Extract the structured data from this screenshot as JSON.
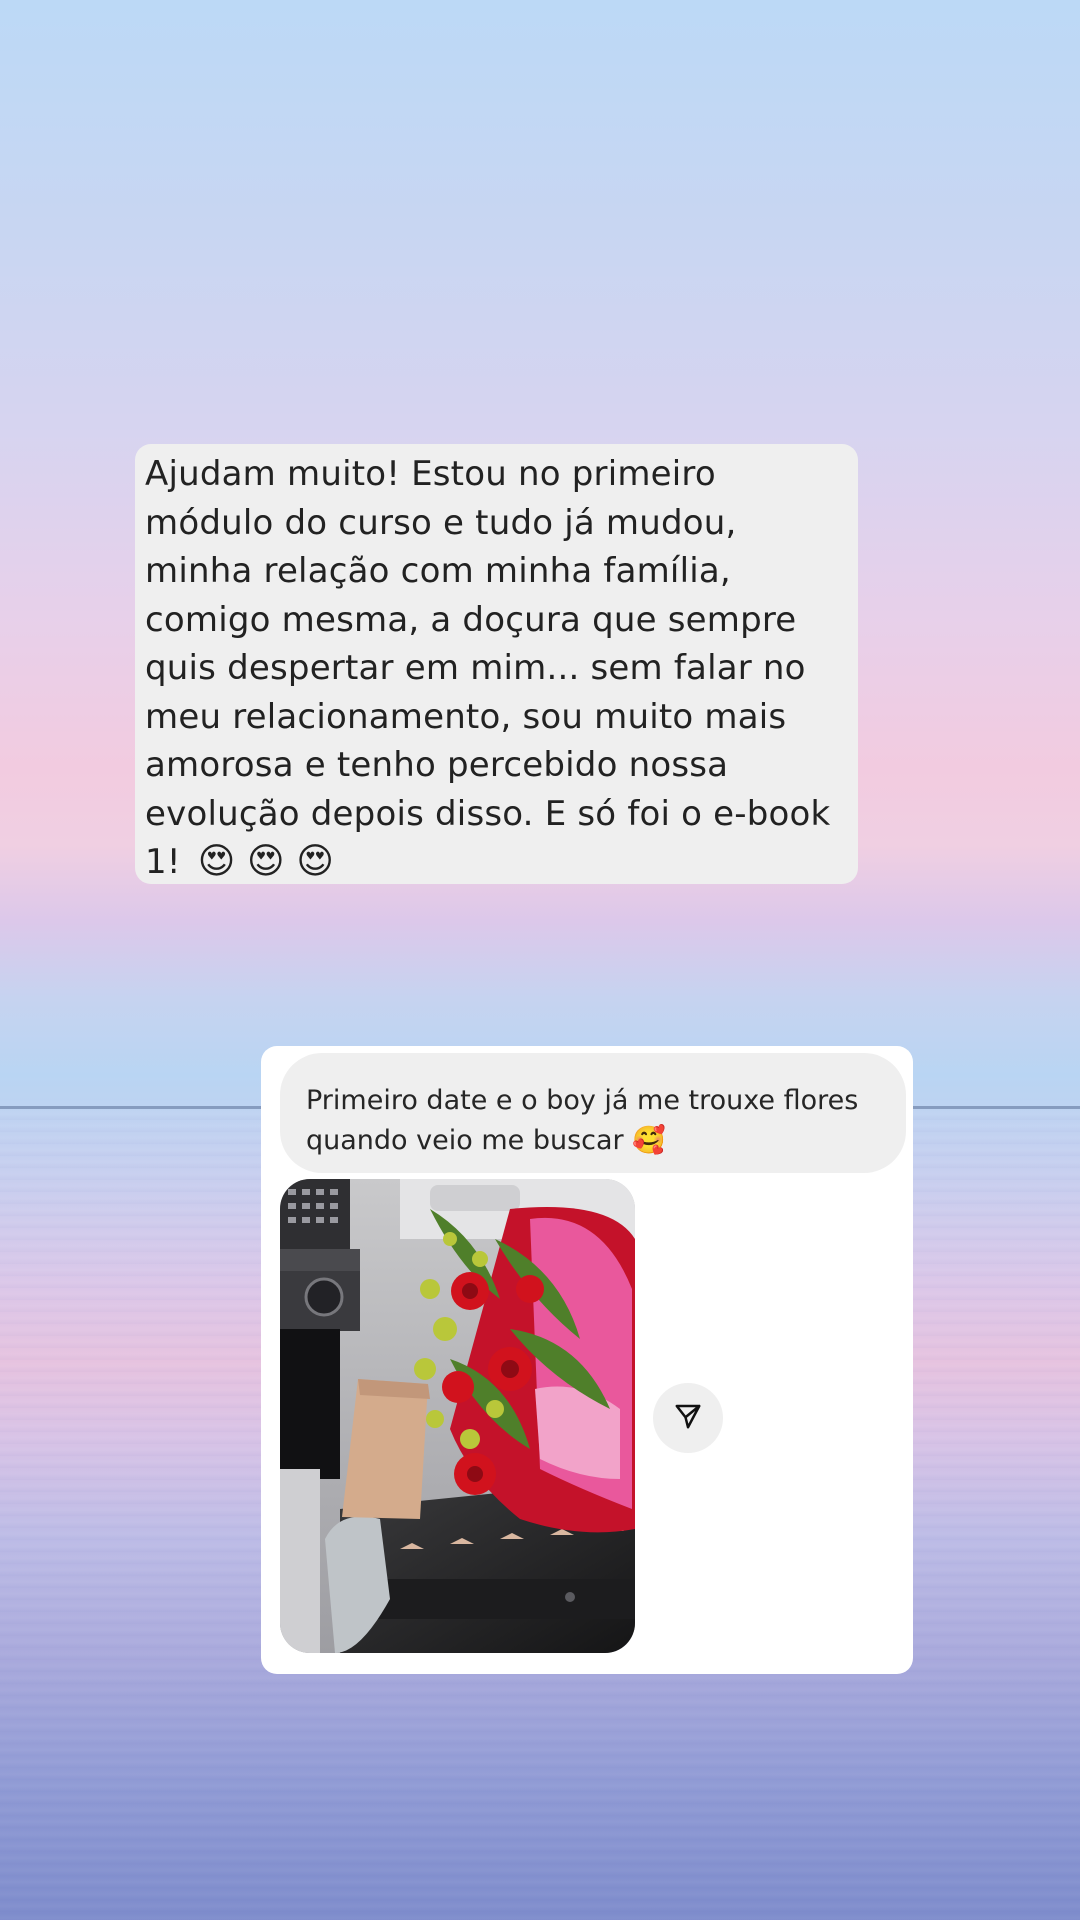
{
  "messages": {
    "main_text": "Ajudam muito! Estou no primeiro módulo do curso e tudo já mudou, minha relação com minha família, comigo mesma, a doçura que sempre quis despertar em mim... sem falar no meu relacionamento, sou muito mais amorosa e tenho percebido nossa evolução depois disso. E só foi o e-book 1!",
    "main_emojis": "😍 😍 😍",
    "reply_text": "Primeiro date e o boy já me trouxe flores quando veio me buscar",
    "reply_emoji": "🥰"
  },
  "icons": {
    "share": "paper-plane-icon"
  },
  "colors": {
    "bubble_bg": "#efefef",
    "card_bg": "#ffffff",
    "text": "#222222"
  }
}
